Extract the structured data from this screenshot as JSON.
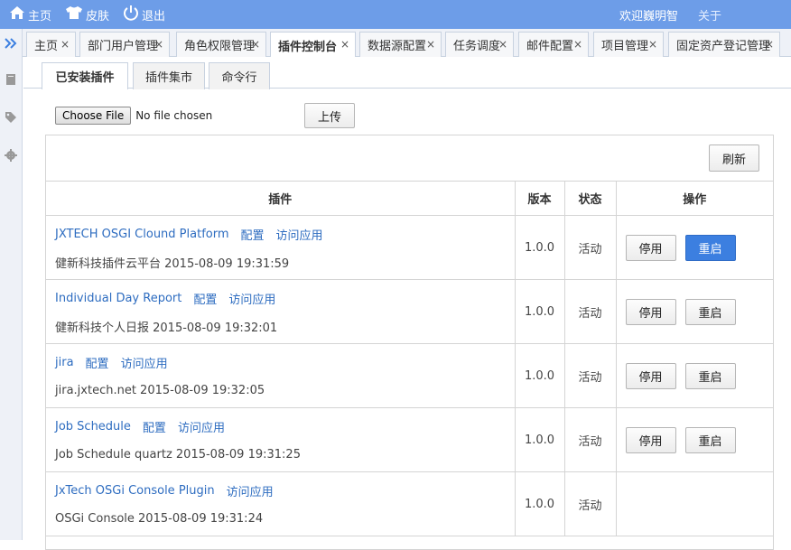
{
  "topbar": {
    "home_label": "主页",
    "skin_label": "皮肤",
    "logout_label": "退出",
    "welcome": "欢迎巍明智",
    "about": "关于"
  },
  "tabs": [
    {
      "label": "主页",
      "active": false
    },
    {
      "label": "部门用户管理",
      "active": false
    },
    {
      "label": "角色权限管理",
      "active": false
    },
    {
      "label": "插件控制台",
      "active": true
    },
    {
      "label": "数据源配置",
      "active": false
    },
    {
      "label": "任务调度",
      "active": false
    },
    {
      "label": "邮件配置",
      "active": false
    },
    {
      "label": "项目管理",
      "active": false
    },
    {
      "label": "固定资产登记管理",
      "active": false
    }
  ],
  "tab_close_glyph": "×",
  "subtabs": [
    {
      "label": "已安装插件",
      "active": true
    },
    {
      "label": "插件集市",
      "active": false
    },
    {
      "label": "命令行",
      "active": false
    }
  ],
  "upload": {
    "choose_file": "Choose File",
    "no_file": "No file chosen",
    "upload_button": "上传"
  },
  "refresh_button": "刷新",
  "table": {
    "headers": [
      "插件",
      "版本",
      "状态",
      "操作"
    ],
    "rows": [
      {
        "name": "JXTECH OSGI Clound Platform",
        "links": [
          "配置",
          "访问应用"
        ],
        "desc": "健新科技插件云平台  2015-08-09 19:31:59",
        "version": "1.0.0",
        "status": "活动",
        "actions": [
          "停用",
          "重启"
        ]
      },
      {
        "name": "Individual Day Report",
        "links": [
          "配置",
          "访问应用"
        ],
        "desc": "健新科技个人日报  2015-08-09 19:32:01",
        "version": "1.0.0",
        "status": "活动",
        "actions": [
          "停用",
          "重启"
        ]
      },
      {
        "name": "jira",
        "links": [
          "配置",
          "访问应用"
        ],
        "desc": "jira.jxtech.net  2015-08-09 19:32:05",
        "version": "1.0.0",
        "status": "活动",
        "actions": [
          "停用",
          "重启"
        ]
      },
      {
        "name": "Job Schedule",
        "links": [
          "配置",
          "访问应用"
        ],
        "desc": "Job Schedule quartz  2015-08-09 19:31:25",
        "version": "1.0.0",
        "status": "活动",
        "actions": [
          "停用",
          "重启"
        ]
      },
      {
        "name": "JxTech OSGi Console Plugin",
        "links": [
          "访问应用"
        ],
        "desc": "OSGi Console  2015-08-09 19:31:24",
        "version": "1.0.0",
        "status": "活动",
        "actions": []
      }
    ]
  },
  "colors": {
    "topbar": "#6d9de8",
    "link": "#2d6cc0",
    "primary_button": "#3c7fe0"
  }
}
